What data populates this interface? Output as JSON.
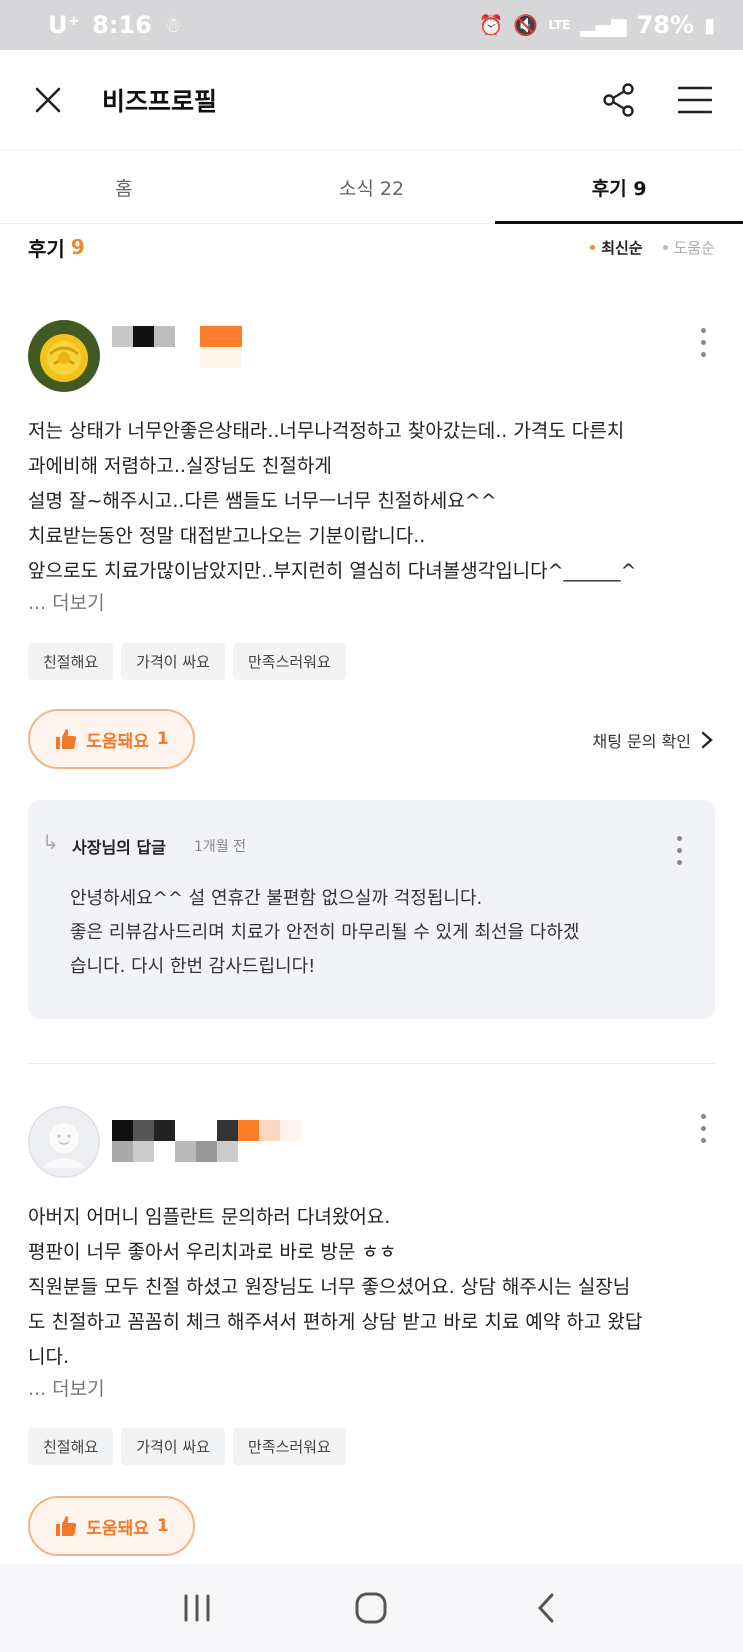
{
  "status_bar": {
    "carrier": "U⁺",
    "time": "8:16",
    "network": "LTE",
    "battery": "78%"
  },
  "app_bar": {
    "title": "비즈프로필"
  },
  "tabs": [
    {
      "label": "홈",
      "active": false
    },
    {
      "label": "소식 22",
      "active": false
    },
    {
      "label": "후기 9",
      "active": true
    }
  ],
  "reviews_header": {
    "title": "후기",
    "count": "9",
    "sort_options": [
      "최신순",
      "도움순"
    ],
    "sort_selected": "최신순"
  },
  "reviews": [
    {
      "body": [
        "저는 상태가 너무안좋은상태라..너무나걱정하고 찾아갔는데.. 가격도 다른치",
        "과에비해 저렴하고..실장님도 친절하게",
        "설명 잘~해주시고..다른 쌤들도 너무ㅡ너무 친절하세요^^",
        "치료받는동안 정말 대접받고나오는 기분이랍니다..",
        "앞으로도 치료가많이남았지만..부지런히 열심히 다녀볼생각입니다^______^"
      ],
      "see_more": "... 더보기",
      "tags": [
        "친절해요",
        "가격이 싸요",
        "만족스러워요"
      ],
      "helpful_label": "도움돼요",
      "helpful_count": "1",
      "chat_link": "채팅 문의 확인",
      "reply": {
        "author": "사장님의 답글",
        "time": "1개월 전",
        "text": [
          "안녕하세요^^ 설 연휴간 불편함 없으실까 걱정됩니다.",
          "좋은 리뷰감사드리며 치료가 안전히 마무리될 수 있게 최선을 다하겠",
          "습니다. 다시 한번 감사드립니다!"
        ]
      }
    },
    {
      "body": [
        "아버지 어머니 임플란트 문의하러 다녀왔어요.",
        "평판이 너무 좋아서 우리치과로 바로 방문 ㅎㅎ",
        "직원분들 모두 친절 하셨고 원장님도 너무 좋으셨어요. 상담 해주시는 실장님",
        "도 친절하고 꼼꼼히 체크 해주셔서 편하게 상담 받고 바로 치료 예약 하고 왔답",
        "니다."
      ],
      "see_more": "... 더보기",
      "tags": [
        "친절해요",
        "가격이 싸요",
        "만족스러워요"
      ],
      "helpful_label": "도움돼요",
      "helpful_count": "1"
    }
  ],
  "colors": {
    "accent": "#f08a32",
    "reply_bg": "#f2f3f6",
    "chip_bg": "#f2f3f5"
  }
}
